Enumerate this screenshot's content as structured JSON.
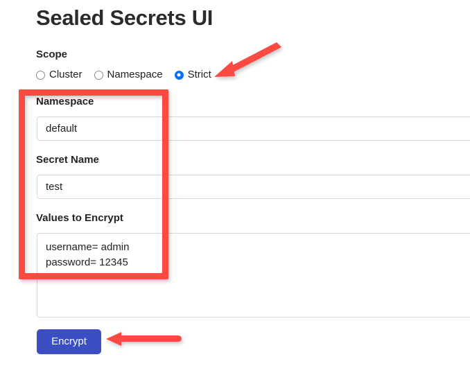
{
  "page": {
    "title": "Sealed Secrets UI"
  },
  "form": {
    "scope": {
      "label": "Scope",
      "options": [
        {
          "label": "Cluster",
          "selected": false
        },
        {
          "label": "Namespace",
          "selected": false
        },
        {
          "label": "Strict",
          "selected": true
        }
      ]
    },
    "namespace": {
      "label": "Namespace",
      "value": "default"
    },
    "secret_name": {
      "label": "Secret Name",
      "value": "test"
    },
    "values_to_encrypt": {
      "label": "Values to Encrypt",
      "value": "username= admin\npassword= 12345"
    },
    "submit": {
      "label": "Encrypt"
    }
  },
  "annotations": {
    "highlight_color": "#fb4a42",
    "box": {
      "name": "fields-highlight-box"
    },
    "arrow_to_strict": {
      "name": "arrow-pointing-to-strict-radio"
    },
    "arrow_to_encrypt": {
      "name": "arrow-pointing-to-encrypt-button"
    }
  },
  "colors": {
    "button_blue": "#3b4fc4",
    "radio_selected_blue": "#0d6efd",
    "annotation_red": "#fb4a42"
  }
}
